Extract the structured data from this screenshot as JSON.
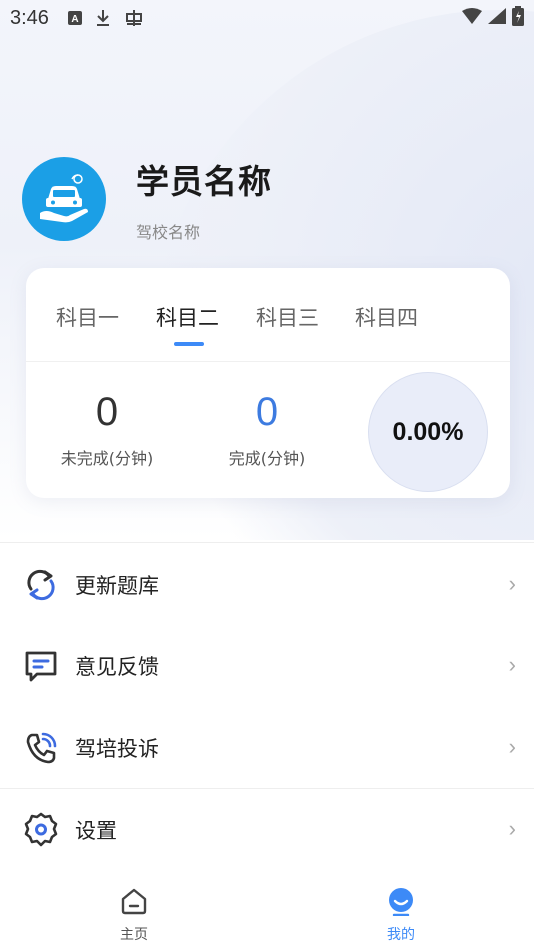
{
  "status_bar": {
    "time": "3:46"
  },
  "profile": {
    "student_name": "学员名称",
    "school_name": "驾校名称"
  },
  "subject_tabs": {
    "items": [
      {
        "label": "科目一",
        "active": false
      },
      {
        "label": "科目二",
        "active": true
      },
      {
        "label": "科目三",
        "active": false
      },
      {
        "label": "科目四",
        "active": false
      }
    ]
  },
  "stats": {
    "incomplete_value": "0",
    "incomplete_label": "未完成(分钟)",
    "complete_value": "0",
    "complete_label": "完成(分钟)",
    "progress": "0.00%"
  },
  "menu": {
    "items": [
      {
        "label": "更新题库",
        "icon": "refresh-icon"
      },
      {
        "label": "意见反馈",
        "icon": "feedback-icon"
      },
      {
        "label": "驾培投诉",
        "icon": "phone-call-icon"
      },
      {
        "label": "设置",
        "icon": "gear-icon"
      }
    ],
    "chevron": "›"
  },
  "bottom_nav": {
    "items": [
      {
        "label": "主页",
        "icon": "home-icon",
        "active": false
      },
      {
        "label": "我的",
        "icon": "profile-icon",
        "active": true
      }
    ]
  },
  "colors": {
    "accent": "#3d8af7",
    "avatar_bg": "#1b9fe6",
    "inactive_nav": "#555555"
  }
}
